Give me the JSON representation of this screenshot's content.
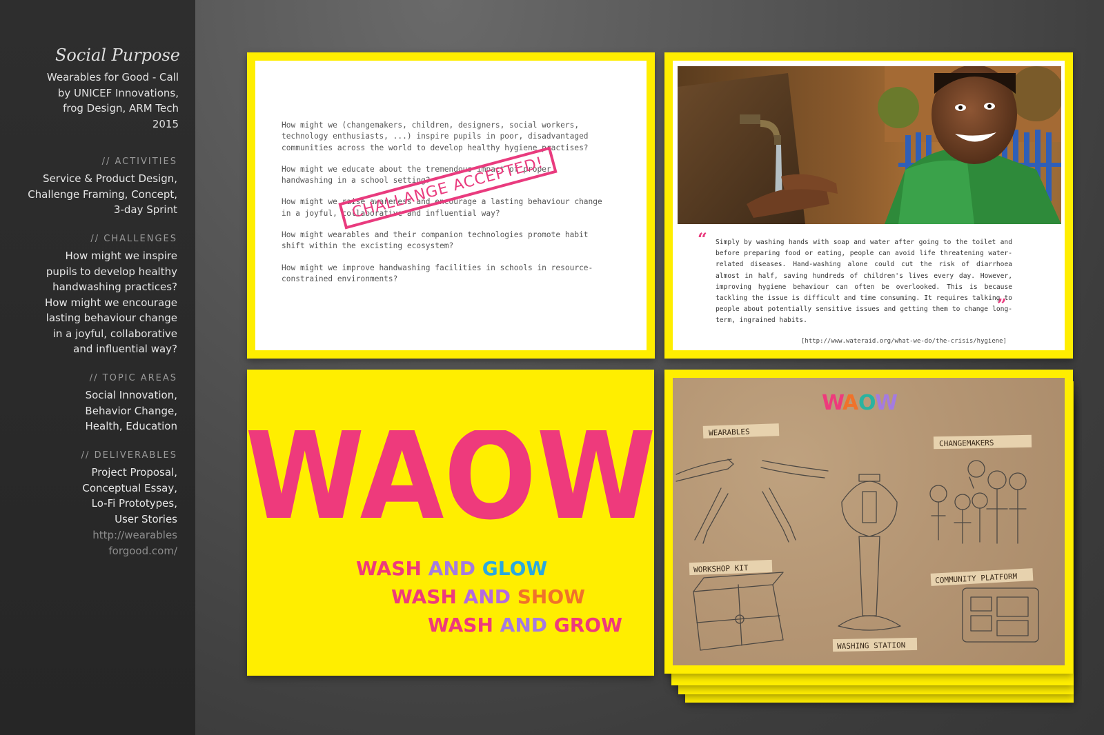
{
  "sidebar": {
    "title": "Social Purpose",
    "subtitle": [
      "Wearables for Good - Call",
      "by UNICEF Innovations,",
      "frog Design, ARM Tech",
      "2015"
    ],
    "sections": [
      {
        "heading": "// ACTIVITIES",
        "lines": [
          "Service & Product Design,",
          "Challenge Framing, Concept,",
          "3-day Sprint"
        ]
      },
      {
        "heading": "// CHALLENGES",
        "lines": [
          "How might we inspire",
          "pupils to develop healthy",
          "handwashing practices?",
          "How might we encourage",
          "lasting behaviour change",
          "in a joyful, collaborative",
          "and influential way?"
        ]
      },
      {
        "heading": "// TOPIC AREAS",
        "lines": [
          "Social Innovation,",
          "Behavior Change,",
          "Health, Education"
        ]
      },
      {
        "heading": "// DELIVERABLES",
        "lines": [
          "Project Proposal,",
          "Conceptual Essay,",
          "Lo-Fi Prototypes,",
          "User Stories"
        ]
      }
    ],
    "link": [
      "http://wearables",
      "forgood.com/"
    ]
  },
  "panel1": {
    "questions": [
      "How might we (changemakers, children, designers, social workers, technology enthusiasts, ...)  inspire pupils in poor, disadvantaged communities across the world to develop healthy hygiene practises?",
      "How might we educate about the tremendous impact of proper handwashing in a school setting?",
      "How might we raise awareness and encourage a lasting behaviour change in a joyful, collaborative and influential way?",
      "How might wearables and their companion technologies promote habit shift within the excisting ecosystem?",
      "How might we improve handwashing facilities in schools in resource-constrained environments?"
    ],
    "stamp": "CHALLANGE ACCEPTED!"
  },
  "panel2": {
    "quote": "Simply by washing hands with soap and water after going to the toilet and before preparing food or eating, people can avoid life threatening water-related diseases. Hand-washing alone could cut the risk of diarrhoea almost in half, saving hundreds of children's lives every day. However, improving hygiene behaviour can often be overlooked. This is because tackling the issue is difficult and time consuming. It requires talking to people about potentially sensitive issues and getting them to change long-term, ingrained habits.",
    "open_quote": "“",
    "close_quote": "”",
    "source": "[http://www.wateraid.org/what-we-do/the-crisis/hygiene]"
  },
  "panel3": {
    "big_word": "WAOW",
    "lines": [
      [
        "WASH ",
        "AND ",
        "GLOW"
      ],
      [
        "WASH ",
        "AND ",
        "SHOW"
      ],
      [
        "WASH ",
        "AND ",
        "GROW"
      ]
    ]
  },
  "panel4": {
    "title": "WAOW",
    "labels": {
      "wearables": "WEARABLES",
      "changemakers": "CHANGEMAKERS",
      "workshop_kit": "WORKSHOP KIT",
      "community_platform": "COMMUNITY PLATFORM",
      "washing_station": "WASHING STATION"
    }
  },
  "colors": {
    "yellow": "#ffee00",
    "pink": "#ee3a7c",
    "sidebar_bg": "#2a2a2a"
  }
}
